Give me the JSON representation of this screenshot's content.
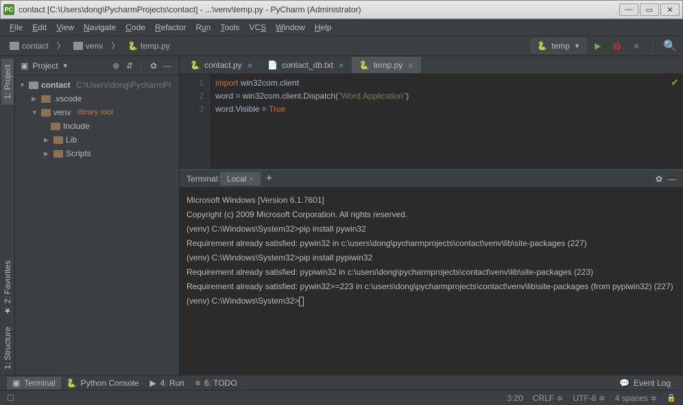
{
  "titlebar": {
    "title": "contact [C:\\Users\\dong\\PycharmProjects\\contact] - ...\\venv\\temp.py - PyCharm (Administrator)"
  },
  "menu": [
    "File",
    "Edit",
    "View",
    "Navigate",
    "Code",
    "Refactor",
    "Run",
    "Tools",
    "VCS",
    "Window",
    "Help"
  ],
  "breadcrumb": {
    "root": "contact",
    "mid": "venv",
    "file": "temp.py"
  },
  "runconfig": {
    "name": "temp"
  },
  "project_header": "Project",
  "tree": {
    "root": {
      "name": "contact",
      "path": "C:\\Users\\dong\\PycharmPr"
    },
    "vscode": ".vscode",
    "venv": "venv",
    "venv_tag": "library root",
    "include": "Include",
    "lib": "Lib",
    "scripts": "Scripts"
  },
  "tabs": [
    {
      "label": "contact.py",
      "active": false
    },
    {
      "label": "contact_db.txt",
      "active": false
    },
    {
      "label": "temp.py",
      "active": true
    }
  ],
  "code": {
    "lines": [
      {
        "n": "1",
        "segs": [
          {
            "t": "import ",
            "c": "kw"
          },
          {
            "t": "win32com.client",
            "c": ""
          }
        ]
      },
      {
        "n": "2",
        "segs": [
          {
            "t": "word = win32com.client.Dispatch(",
            "c": ""
          },
          {
            "t": "\"Word.Application\"",
            "c": "str"
          },
          {
            "t": ")",
            "c": ""
          }
        ]
      },
      {
        "n": "3",
        "segs": [
          {
            "t": "word.Visible = ",
            "c": ""
          },
          {
            "t": "True",
            "c": "val"
          }
        ]
      }
    ]
  },
  "terminal": {
    "header_label": "Terminal:",
    "tab": "Local",
    "lines": [
      "Microsoft Windows [Version 6.1.7601]",
      "Copyright (c) 2009 Microsoft Corporation. All rights reserved.",
      "",
      "",
      "(venv) C:\\Windows\\System32>pip install pywin32",
      "Requirement already satisfied: pywin32 in c:\\users\\dong\\pycharmprojects\\contact\\venv\\lib\\site-packages (227)",
      "",
      "",
      "(venv) C:\\Windows\\System32>pip install pypiwin32",
      "Requirement already satisfied: pypiwin32 in c:\\users\\dong\\pycharmprojects\\contact\\venv\\lib\\site-packages (223)",
      "Requirement already satisfied: pywin32>=223 in c:\\users\\dong\\pycharmprojects\\contact\\venv\\lib\\site-packages (from pypiwin32) (227)",
      "",
      "",
      "(venv) C:\\Windows\\System32>"
    ]
  },
  "bottom_tabs": {
    "terminal": "Terminal",
    "python_console": "Python Console",
    "run": "4: Run",
    "todo": "6: TODO",
    "event_log": "Event Log"
  },
  "left_tabs": {
    "project": "1: Project",
    "structure": "1: Structure",
    "favorites": "2: Favorites"
  },
  "status": {
    "pos": "3:20",
    "crlf": "CRLF",
    "enc": "UTF-8",
    "indent": "4 spaces"
  }
}
